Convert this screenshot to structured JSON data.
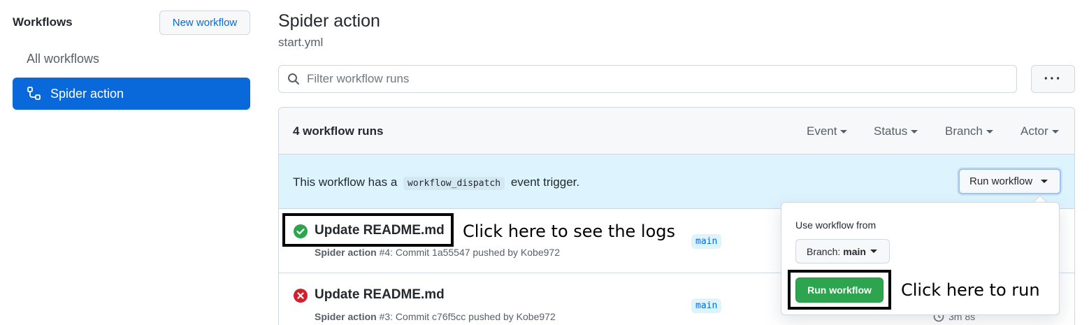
{
  "sidebar": {
    "title": "Workflows",
    "new_workflow_label": "New workflow",
    "items": [
      {
        "label": "All workflows",
        "icon": "none"
      },
      {
        "label": "Spider action",
        "icon": "workflow-icon",
        "active": true
      }
    ]
  },
  "header": {
    "title": "Spider action",
    "subtitle": "start.yml"
  },
  "filter": {
    "placeholder": "Filter workflow runs",
    "more_label": "···"
  },
  "runs_box": {
    "count_label": "4 workflow runs",
    "filters": [
      "Event",
      "Status",
      "Branch",
      "Actor"
    ],
    "dispatch": {
      "prefix": "This workflow has a",
      "code": "workflow_dispatch",
      "suffix": "event trigger.",
      "button_label": "Run workflow"
    },
    "runs": [
      {
        "status": "success",
        "status_icon": "check-circle-icon",
        "title": "Update README.md",
        "workflow": "Spider action",
        "meta": "#4: Commit 1a55547 pushed by Kobe972",
        "branch": "main",
        "duration": ""
      },
      {
        "status": "failure",
        "status_icon": "x-circle-icon",
        "title": "Update README.md",
        "workflow": "Spider action",
        "meta": "#3: Commit c76f5cc pushed by Kobe972",
        "branch": "main",
        "duration": "3m 8s"
      }
    ]
  },
  "popover": {
    "label": "Use workflow from",
    "branch_prefix": "Branch:",
    "branch_value": "main",
    "run_button_label": "Run workflow"
  },
  "annotations": {
    "logs_hint": "Click here to see the logs",
    "run_hint": "Click here to run"
  },
  "colors": {
    "accent": "#0969da",
    "success": "#2da44e",
    "danger": "#cf222e",
    "dispatch_bg": "#ddf4ff"
  }
}
